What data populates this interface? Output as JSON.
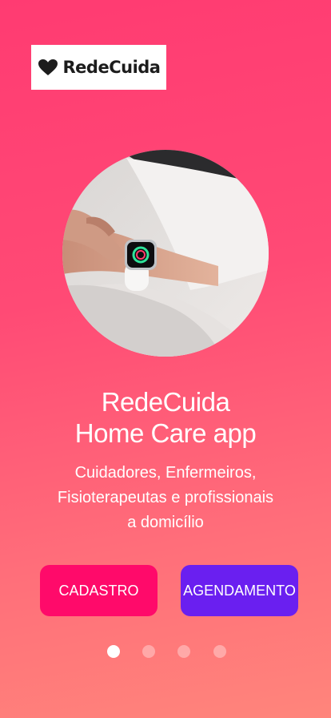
{
  "brand": {
    "logo_text": "RedeCuida"
  },
  "hero": {
    "title_line1": "RedeCuida",
    "title_line2": "Home Care app",
    "subtitle_line1": "Cuidadores, Enfermeiros,",
    "subtitle_line2": "Fisioterapeutas e profissionais",
    "subtitle_line3": "a domicílio"
  },
  "actions": {
    "cadastro_label": "CADASTRO",
    "agendamento_label": "AGENDAMENTO"
  },
  "pagination": {
    "total": 4,
    "active_index": 0
  },
  "colors": {
    "gradient_top": "#ff3b72",
    "gradient_bottom": "#ff857b",
    "cadastro_button": "#ff0a6a",
    "agendamento_button": "#6a1ff0"
  },
  "icons": {
    "logo": "heart-icon"
  }
}
